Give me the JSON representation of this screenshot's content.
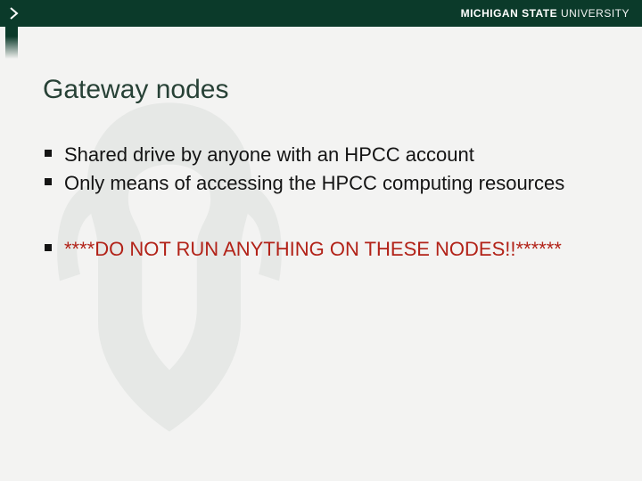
{
  "header": {
    "university_bold": "MICHIGAN STATE",
    "university_light": " UNIVERSITY"
  },
  "title": "Gateway nodes",
  "bullets_main": [
    "Shared drive by anyone with an HPCC account",
    "Only means of accessing the HPCC computing resources"
  ],
  "bullets_warning": [
    "****DO NOT RUN ANYTHING ON THESE NODES!!******"
  ]
}
